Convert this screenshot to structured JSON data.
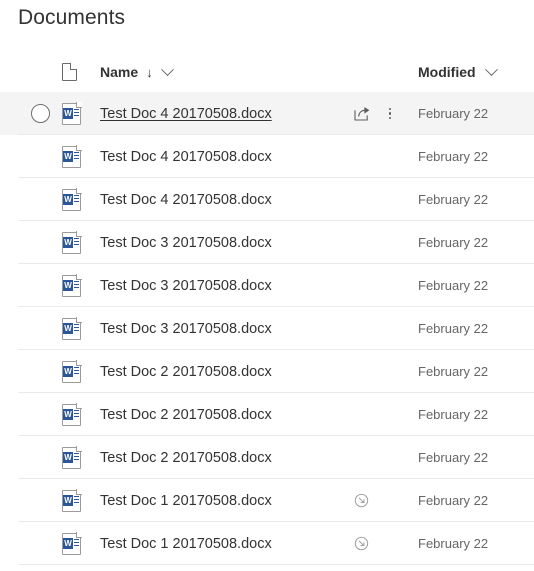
{
  "page": {
    "title": "Documents"
  },
  "columns": {
    "filetype": {
      "icon": "page-icon",
      "label": ""
    },
    "name": {
      "label": "Name",
      "sort_arrow": "↓",
      "sort_direction": "ascending",
      "menu_icon": "chevron-down-icon"
    },
    "modified": {
      "label": "Modified",
      "menu_icon": "chevron-down-icon"
    }
  },
  "colors": {
    "word_blue": "#2b579a",
    "row_selected_bg": "#f4f4f4",
    "row_divider": "#eaeaea",
    "text_primary": "#333333",
    "text_secondary": "#666666"
  },
  "rows": [
    {
      "name": "Test Doc 4 20170508.docx",
      "modified": "February 22",
      "filetype": "word-document",
      "selected": true,
      "has_share": true,
      "has_more": true,
      "has_sync": false
    },
    {
      "name": "Test Doc 4 20170508.docx",
      "modified": "February 22",
      "filetype": "word-document",
      "selected": false,
      "has_share": false,
      "has_more": false,
      "has_sync": false
    },
    {
      "name": "Test Doc 4 20170508.docx",
      "modified": "February 22",
      "filetype": "word-document",
      "selected": false,
      "has_share": false,
      "has_more": false,
      "has_sync": false
    },
    {
      "name": "Test Doc 3 20170508.docx",
      "modified": "February 22",
      "filetype": "word-document",
      "selected": false,
      "has_share": false,
      "has_more": false,
      "has_sync": false
    },
    {
      "name": "Test Doc 3 20170508.docx",
      "modified": "February 22",
      "filetype": "word-document",
      "selected": false,
      "has_share": false,
      "has_more": false,
      "has_sync": false
    },
    {
      "name": "Test Doc 3 20170508.docx",
      "modified": "February 22",
      "filetype": "word-document",
      "selected": false,
      "has_share": false,
      "has_more": false,
      "has_sync": false
    },
    {
      "name": "Test Doc 2 20170508.docx",
      "modified": "February 22",
      "filetype": "word-document",
      "selected": false,
      "has_share": false,
      "has_more": false,
      "has_sync": false
    },
    {
      "name": "Test Doc 2 20170508.docx",
      "modified": "February 22",
      "filetype": "word-document",
      "selected": false,
      "has_share": false,
      "has_more": false,
      "has_sync": false
    },
    {
      "name": "Test Doc 2 20170508.docx",
      "modified": "February 22",
      "filetype": "word-document",
      "selected": false,
      "has_share": false,
      "has_more": false,
      "has_sync": false
    },
    {
      "name": "Test Doc 1 20170508.docx",
      "modified": "February 22",
      "filetype": "word-document",
      "selected": false,
      "has_share": false,
      "has_more": false,
      "has_sync": true
    },
    {
      "name": "Test Doc 1 20170508.docx",
      "modified": "February 22",
      "filetype": "word-document",
      "selected": false,
      "has_share": false,
      "has_more": false,
      "has_sync": true
    }
  ],
  "word_icon": {
    "letter": "W"
  }
}
